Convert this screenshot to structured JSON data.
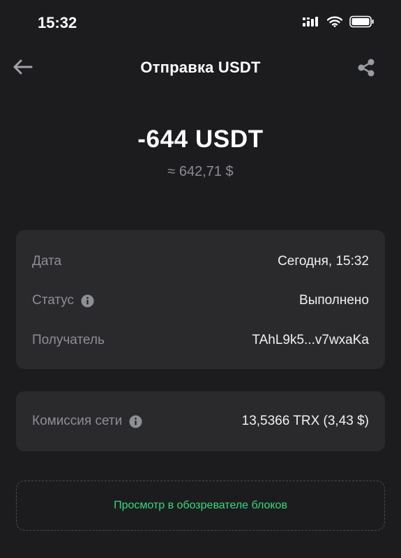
{
  "status_bar": {
    "time": "15:32"
  },
  "nav": {
    "title": "Отправка USDT"
  },
  "amount": {
    "value": "-644 USDT",
    "fiat": "≈ 642,71 $"
  },
  "details": {
    "date_label": "Дата",
    "date_value": "Сегодня, 15:32",
    "status_label": "Статус",
    "status_value": "Выполнено",
    "recipient_label": "Получатель",
    "recipient_value": "TAhL9k5...v7wxaKa"
  },
  "fee": {
    "label": "Комиссия сети",
    "value": "13,5366 TRX (3,43 $)"
  },
  "explorer": {
    "label": "Просмотр в обозревателе блоков"
  },
  "colors": {
    "background": "#1c1c1e",
    "card": "#2a2a2d",
    "accent_green": "#2fdc7f",
    "muted": "#8e8f94"
  }
}
